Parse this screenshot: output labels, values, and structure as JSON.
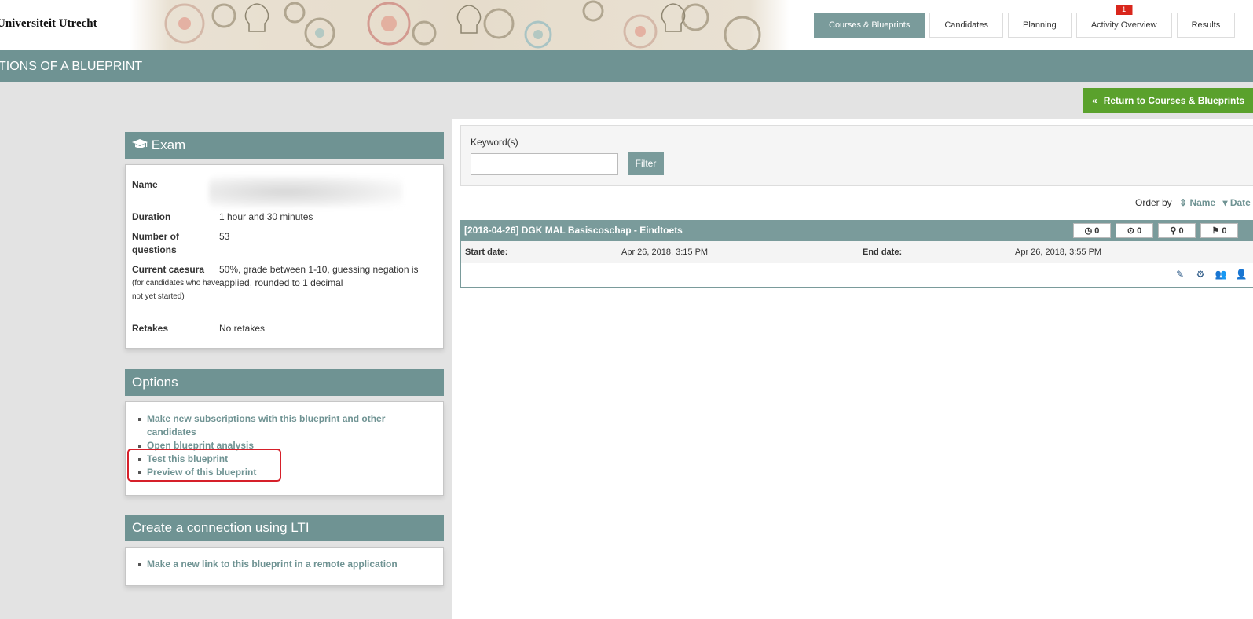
{
  "header": {
    "logo_text": "Universiteit Utrecht",
    "nav": [
      {
        "label": "Courses & Blueprints",
        "active": true
      },
      {
        "label": "Candidates"
      },
      {
        "label": "Planning"
      },
      {
        "label": "Activity Overview",
        "badge": "1"
      },
      {
        "label": "Results"
      }
    ]
  },
  "page_title": "TIONS OF A BLUEPRINT",
  "return_button": {
    "icon": "double-chevron-left-icon",
    "label": "Return to Courses & Blueprints"
  },
  "exam_panel": {
    "title": "Exam",
    "icon": "graduation-cap-icon",
    "fields": {
      "name_label": "Name",
      "duration_label": "Duration",
      "duration_value": "1 hour and 30 minutes",
      "questions_label": "Number of questions",
      "questions_value": "53",
      "caesura_label": "Current caesura",
      "caesura_note": "(for candidates who have not yet started)",
      "caesura_value": "50%, grade between 1-10, guessing negation is applied, rounded to 1 decimal",
      "retakes_label": "Retakes",
      "retakes_value": "No retakes"
    }
  },
  "options_panel": {
    "title": "Options",
    "items": [
      "Make new subscriptions with this blueprint and other candidates",
      "Open blueprint analysis",
      "Test this blueprint",
      "Preview of this blueprint"
    ]
  },
  "lti_panel": {
    "title": "Create a connection using LTI",
    "items": [
      "Make a new link to this blueprint in a remote application"
    ]
  },
  "filter": {
    "keyword_label": "Keyword(s)",
    "keyword_value": "",
    "button_label": "Filter"
  },
  "order_by": {
    "label": "Order by",
    "options": [
      "Name",
      "Date"
    ]
  },
  "exam_list": [
    {
      "title": "[2018-04-26] DGK MAL Basiscoschap - Eindtoets",
      "counts": [
        {
          "icon": "clock-icon",
          "value": "0"
        },
        {
          "icon": "play-circle-icon",
          "value": "0"
        },
        {
          "icon": "search-icon",
          "value": "0"
        },
        {
          "icon": "flag-icon",
          "value": "0"
        }
      ],
      "start_label": "Start date:",
      "start_value": "Apr 26, 2018, 3:15 PM",
      "end_label": "End date:",
      "end_value": "Apr 26, 2018, 3:55 PM",
      "actions": [
        "edit-icon",
        "settings-icon",
        "group-icon",
        "user-settings-icon"
      ]
    }
  ],
  "colors": {
    "teal": "#6f9393",
    "green": "#5aa12c",
    "highlight": "#d6202a"
  }
}
